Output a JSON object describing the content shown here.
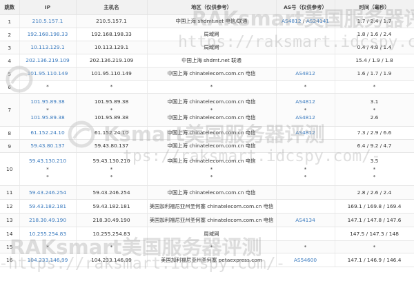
{
  "headers": [
    "跳数",
    "IP",
    "主机名",
    "地区（仅供参考）",
    "AS号（仅供参考）",
    "时间（毫秒）"
  ],
  "rows": [
    {
      "hop": "1",
      "lines": [
        {
          "ip": "210.5.157.1",
          "host": "210.5.157.1",
          "geo": "中国上海 shdmt.net 电信/联通",
          "as": [
            "AS4812",
            "AS24141"
          ],
          "time": "1.7 / 2.4 / 1.7"
        }
      ]
    },
    {
      "hop": "2",
      "lines": [
        {
          "ip": "192.168.198.33",
          "host": "192.168.198.33",
          "geo": "局域网",
          "as": [],
          "time": "1.8 / 1.6 / 2.4"
        }
      ]
    },
    {
      "hop": "3",
      "lines": [
        {
          "ip": "10.113.129.1",
          "host": "10.113.129.1",
          "geo": "局域网",
          "as": [],
          "time": "0.4 / 4.8 / 1.4"
        }
      ]
    },
    {
      "hop": "4",
      "lines": [
        {
          "ip": "202.136.219.109",
          "host": "202.136.219.109",
          "geo": "中国上海 shdmt.net 联通",
          "as": [],
          "time": "15.4 / 1.9 / 1.8"
        }
      ]
    },
    {
      "hop": "5",
      "lines": [
        {
          "ip": "101.95.110.149",
          "host": "101.95.110.149",
          "geo": "中国上海 chinatelecom.com.cn 电信",
          "as": [
            "AS4812"
          ],
          "time": "1.6 / 1.7 / 1.9"
        }
      ]
    },
    {
      "hop": "6",
      "lines": [
        {
          "ip": "*",
          "host": "*",
          "geo": "*",
          "as": [
            "*"
          ],
          "time": "*"
        }
      ]
    },
    {
      "hop": "7",
      "lines": [
        {
          "ip": "101.95.89.38",
          "host": "101.95.89.38",
          "geo": "中国上海 chinatelecom.com.cn 电信",
          "as": [
            "AS4812"
          ],
          "time": "3.1"
        },
        {
          "ip": "*",
          "host": "*",
          "geo": "*",
          "as": [
            "*"
          ],
          "time": "*"
        },
        {
          "ip": "101.95.89.38",
          "host": "101.95.89.38",
          "geo": "中国上海 chinatelecom.com.cn 电信",
          "as": [
            "AS4812"
          ],
          "time": "2.6"
        }
      ]
    },
    {
      "hop": "8",
      "lines": [
        {
          "ip": "61.152.24.10",
          "host": "61.152.24.10",
          "geo": "中国上海 chinatelecom.com.cn 电信",
          "as": [
            "AS4812"
          ],
          "time": "7.3 / 2.9 / 6.6"
        }
      ]
    },
    {
      "hop": "9",
      "lines": [
        {
          "ip": "59.43.80.137",
          "host": "59.43.80.137",
          "geo": "中国上海 chinatelecom.com.cn 电信",
          "as": [],
          "time": "6.4 / 9.2 / 4.7"
        }
      ]
    },
    {
      "hop": "10",
      "lines": [
        {
          "ip": "59.43.130.210",
          "host": "59.43.130.210",
          "geo": "中国上海 chinatelecom.com.cn 电信",
          "as": [],
          "time": "3.5"
        },
        {
          "ip": "*",
          "host": "*",
          "geo": "*",
          "as": [
            "*"
          ],
          "time": "*"
        },
        {
          "ip": "*",
          "host": "*",
          "geo": "*",
          "as": [
            "*"
          ],
          "time": "*"
        }
      ]
    },
    {
      "hop": "11",
      "lines": [
        {
          "ip": "59.43.246.254",
          "host": "59.43.246.254",
          "geo": "中国上海 chinatelecom.com.cn 电信",
          "as": [],
          "time": "2.8 / 2.6 / 2.4"
        }
      ]
    },
    {
      "hop": "12",
      "lines": [
        {
          "ip": "59.43.182.181",
          "host": "59.43.182.181",
          "geo": "美国加利福尼亚州圣何塞 chinatelecom.com.cn 电信",
          "as": [],
          "time": "169.1 / 169.8 / 169.4"
        }
      ]
    },
    {
      "hop": "13",
      "lines": [
        {
          "ip": "218.30.49.190",
          "host": "218.30.49.190",
          "geo": "美国加利福尼亚州圣何塞 chinatelecom.com.cn 电信",
          "as": [
            "AS4134"
          ],
          "time": "147.1 / 147.8 / 147.6"
        }
      ]
    },
    {
      "hop": "14",
      "lines": [
        {
          "ip": "10.255.254.83",
          "host": "10.255.254.83",
          "geo": "局域网",
          "as": [],
          "time": "147.5 / 147.3 / 148"
        }
      ]
    },
    {
      "hop": "15",
      "lines": [
        {
          "ip": "*",
          "host": "*",
          "geo": "*",
          "as": [
            "*"
          ],
          "time": "*"
        }
      ]
    },
    {
      "hop": "16",
      "lines": [
        {
          "ip": "104.233.146.99",
          "host": "104.233.146.99",
          "geo": "美国加利福尼亚州圣何塞 petaexpress.com",
          "as": [
            "AS54600"
          ],
          "time": "147.1 / 146.9 / 146.4"
        }
      ]
    }
  ],
  "watermark": {
    "brand": "RAKsmart美国服务器评测",
    "brand_partial": "Ksmart美国服务器评测",
    "url": "https://raksmart.idcspy.com/",
    "url_partial": "tps://raksmart.idcspy.com/-",
    "url_fragment": "-https://raksmart.idcspy.com/-",
    "brand_fragment": "RAKsmart美国服务器评测",
    "logo_color": "#c8c8c8"
  },
  "colors": {
    "link": "#3b7bbf",
    "header_bg": "#f2f2f2",
    "text": "#333333"
  }
}
